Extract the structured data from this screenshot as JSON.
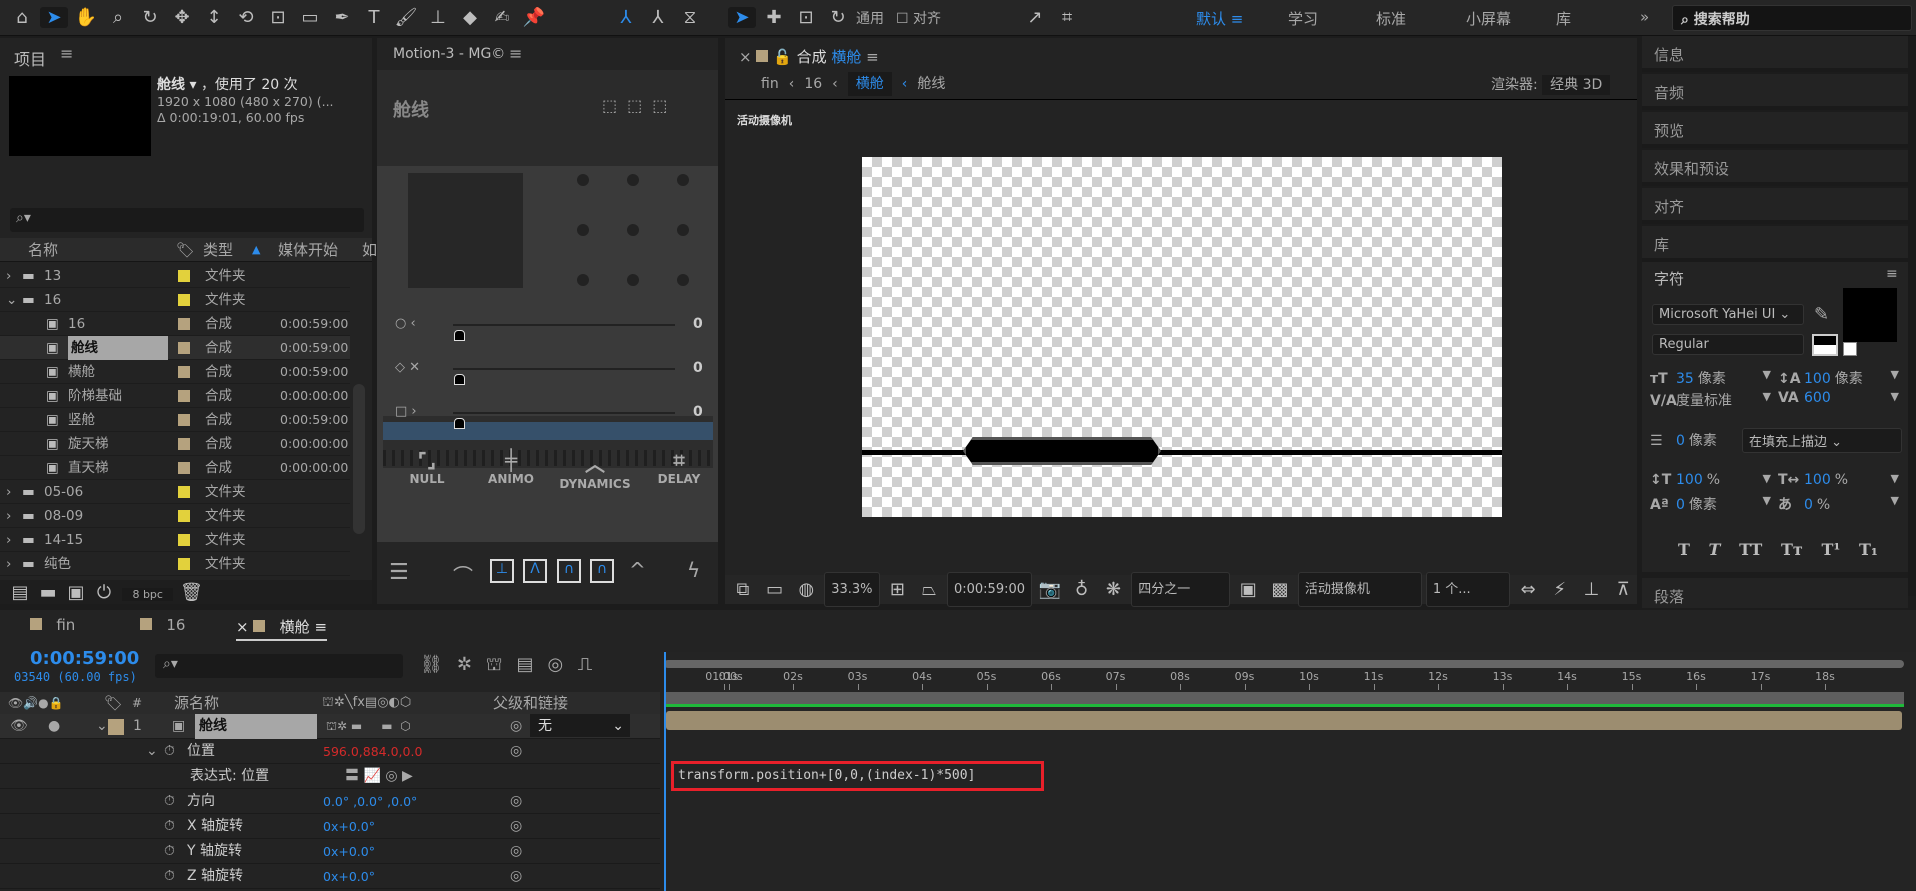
{
  "toolbar": {
    "tools": [
      "home-icon",
      "selection-icon",
      "hand-icon",
      "zoom-icon",
      "rotate-orbit-icon",
      "pan-icon",
      "dolly-icon",
      "rotate-icon",
      "anchor-icon",
      "rectangle-icon",
      "pen-icon",
      "type-icon",
      "brush-icon",
      "clone-stamp-icon",
      "eraser-icon",
      "roto-brush-icon",
      "puppet-pin-icon"
    ],
    "general_label": "通用",
    "align_label": "对齐",
    "workspaces": [
      {
        "label": "默认",
        "active": true
      },
      {
        "label": "学习"
      },
      {
        "label": "标准"
      },
      {
        "label": "小屏幕"
      },
      {
        "label": "库"
      }
    ],
    "search_placeholder": "搜索帮助"
  },
  "project": {
    "title": "项目",
    "selected_name": "舱线",
    "usage": "，使用了 20 次",
    "dims": "1920 x 1080  (480 x 270) (...",
    "duration": "Δ 0:00:19:01, 60.00 fps",
    "columns": [
      "名称",
      "类型",
      "媒体开始",
      "如"
    ],
    "items": [
      {
        "name": "13",
        "type": "文件夹",
        "start": "",
        "kind": "folder",
        "indent": 0,
        "expanded": false
      },
      {
        "name": "16",
        "type": "文件夹",
        "start": "",
        "kind": "folder",
        "indent": 0,
        "expanded": true
      },
      {
        "name": "16",
        "type": "合成",
        "start": "0:00:59:00",
        "kind": "comp",
        "indent": 1
      },
      {
        "name": "舱线",
        "type": "合成",
        "start": "0:00:59:00",
        "kind": "comp",
        "indent": 1,
        "selected": true
      },
      {
        "name": "横舱",
        "type": "合成",
        "start": "0:00:59:00",
        "kind": "comp",
        "indent": 1
      },
      {
        "name": "阶梯基础",
        "type": "合成",
        "start": "0:00:00:00",
        "kind": "comp",
        "indent": 1
      },
      {
        "name": "竖舱",
        "type": "合成",
        "start": "0:00:59:00",
        "kind": "comp",
        "indent": 1
      },
      {
        "name": "旋天梯",
        "type": "合成",
        "start": "0:00:00:00",
        "kind": "comp",
        "indent": 1
      },
      {
        "name": "直天梯",
        "type": "合成",
        "start": "0:00:00:00",
        "kind": "comp",
        "indent": 1
      },
      {
        "name": "05-06",
        "type": "文件夹",
        "start": "",
        "kind": "folder",
        "indent": 0
      },
      {
        "name": "08-09",
        "type": "文件夹",
        "start": "",
        "kind": "folder",
        "indent": 0
      },
      {
        "name": "14-15",
        "type": "文件夹",
        "start": "",
        "kind": "folder",
        "indent": 0
      },
      {
        "name": "纯色",
        "type": "文件夹",
        "start": "",
        "kind": "folder",
        "indent": 0
      }
    ],
    "bpc": "8 bpc"
  },
  "motion": {
    "title": "Motion-3 - MG©",
    "layer_name": "舱线",
    "slider_values": [
      "0",
      "0",
      "0"
    ],
    "buttons": [
      "NULL",
      "ANIMO",
      "DYNAMICS",
      "DELAY"
    ]
  },
  "viewer": {
    "tab_prefix": "合成",
    "tab_name": "横舱",
    "breadcrumbs": [
      "fin",
      "16",
      "横舱",
      "舱线"
    ],
    "renderer_label": "渲染器:",
    "renderer_value": "经典 3D",
    "camera_label": "活动摄像机",
    "zoom": "33.3%",
    "timecode": "0:00:59:00",
    "resolution": "四分之一",
    "camera": "活动摄像机",
    "views": "1 个..."
  },
  "right_panels": [
    "信息",
    "音频",
    "预览",
    "效果和预设",
    "对齐",
    "库"
  ],
  "character": {
    "title": "字符",
    "font": "Microsoft YaHei UI",
    "style": "Regular",
    "size": "35",
    "size_unit": "像素",
    "leading": "100",
    "leading_unit": "像素",
    "kerning": "度量标准",
    "tracking": "600",
    "stroke": "0",
    "stroke_unit": "像素",
    "stroke_mode": "在填充上描边",
    "vscale": "100",
    "hscale": "100",
    "pct": "%",
    "baseline": "0",
    "baseline_unit": "像素",
    "tsume": "0",
    "styles": [
      "T",
      "T",
      "TT",
      "Tт",
      "T¹",
      "T₁"
    ]
  },
  "paragraph_title": "段落",
  "timeline": {
    "tabs": [
      "fin",
      "16",
      "横舱"
    ],
    "current_time": "0:00:59:00",
    "frame_info": "03540 (60.00 fps)",
    "col_source": "源名称",
    "col_parent": "父级和链接",
    "layer": {
      "index": "1",
      "name": "舱线",
      "parent": "无"
    },
    "props": [
      {
        "name": "位置",
        "value": "596.0,884.0,0.0",
        "red": true
      },
      {
        "name": "表达式: 位置",
        "value": ""
      },
      {
        "name": "方向",
        "value": "0.0° ,0.0° ,0.0°"
      },
      {
        "name": "X 轴旋转",
        "value": "0x+0.0°"
      },
      {
        "name": "Y 轴旋转",
        "value": "0x+0.0°"
      },
      {
        "name": "Z 轴旋转",
        "value": "0x+0.0°"
      }
    ],
    "ruler": [
      "01:00s",
      "01s",
      "02s",
      "03s",
      "04s",
      "05s",
      "06s",
      "07s",
      "08s",
      "09s",
      "10s",
      "11s",
      "12s",
      "13s",
      "14s",
      "15s",
      "16s",
      "17s",
      "18s"
    ],
    "expression": "transform.position+[0,0,(index-1)*500]"
  },
  "colors": {
    "accent": "#2d8ceb",
    "comp_label": "#b5a27e",
    "folder_label": "#e2d13c",
    "highlight_box": "#e8202a"
  }
}
